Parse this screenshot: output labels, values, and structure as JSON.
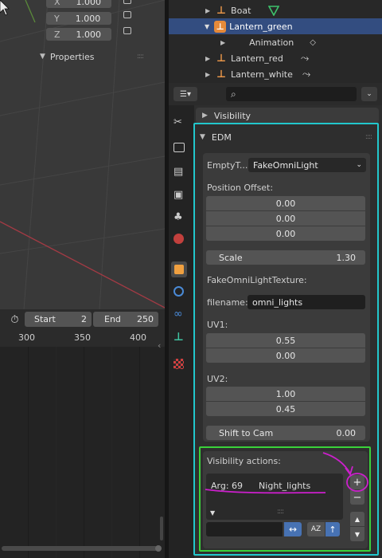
{
  "viewport": {
    "transform_rows": [
      {
        "axis": "X",
        "value": "1.000"
      },
      {
        "axis": "Y",
        "value": "1.000"
      },
      {
        "axis": "Z",
        "value": "1.000"
      }
    ],
    "properties_label": "Properties"
  },
  "timeline": {
    "start_label": "Start",
    "start_value": "2",
    "end_label": "End",
    "end_value": "250",
    "ruler": [
      "300",
      "350",
      "400"
    ]
  },
  "outliner": {
    "items": [
      {
        "label": "Boat"
      },
      {
        "label": "Lantern_green"
      },
      {
        "label": "Animation"
      },
      {
        "label": "Lantern_red"
      },
      {
        "label": "Lantern_white"
      }
    ]
  },
  "properties": {
    "visibility_panel": "Visibility",
    "edm_panel": "EDM",
    "empty_type_label": "EmptyT...",
    "empty_type_value": "FakeOmniLight",
    "position_offset_label": "Position Offset:",
    "position_offset": [
      "0.00",
      "0.00",
      "0.00"
    ],
    "scale_label": "Scale",
    "scale_value": "1.30",
    "texture_label": "FakeOmniLightTexture:",
    "filename_label": "filename:",
    "filename_value": "omni_lights",
    "uv1_label": "UV1:",
    "uv1": [
      "0.55",
      "0.00"
    ],
    "uv2_label": "UV2:",
    "uv2": [
      "1.00",
      "0.45"
    ],
    "shift_label": "Shift to Cam",
    "shift_value": "0.00",
    "visibility_actions_label": "Visibility actions:",
    "action_arg": "Arg: 69",
    "action_name": "Night_lights",
    "add_symbol": "+",
    "remove_symbol": "−",
    "sort_symbol": "AZ"
  },
  "colors": {
    "selected_row": "#334d80",
    "cyan_box": "#22c7cc",
    "green_box": "#3ad13a",
    "magenta_annotation": "#cc1fcc",
    "viewport_bg": "#393939",
    "field_bg": "#545454",
    "accent_blue": "#4772b3"
  }
}
